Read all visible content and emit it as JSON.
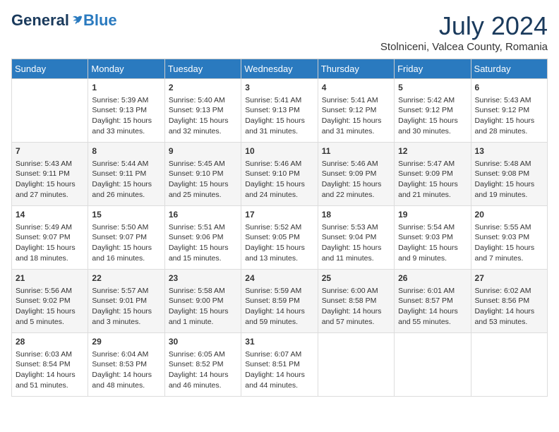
{
  "header": {
    "logo_general": "General",
    "logo_blue": "Blue",
    "title": "July 2024",
    "location": "Stolniceni, Valcea County, Romania"
  },
  "days_of_week": [
    "Sunday",
    "Monday",
    "Tuesday",
    "Wednesday",
    "Thursday",
    "Friday",
    "Saturday"
  ],
  "weeks": [
    [
      {
        "day": "",
        "info": ""
      },
      {
        "day": "1",
        "info": "Sunrise: 5:39 AM\nSunset: 9:13 PM\nDaylight: 15 hours\nand 33 minutes."
      },
      {
        "day": "2",
        "info": "Sunrise: 5:40 AM\nSunset: 9:13 PM\nDaylight: 15 hours\nand 32 minutes."
      },
      {
        "day": "3",
        "info": "Sunrise: 5:41 AM\nSunset: 9:13 PM\nDaylight: 15 hours\nand 31 minutes."
      },
      {
        "day": "4",
        "info": "Sunrise: 5:41 AM\nSunset: 9:12 PM\nDaylight: 15 hours\nand 31 minutes."
      },
      {
        "day": "5",
        "info": "Sunrise: 5:42 AM\nSunset: 9:12 PM\nDaylight: 15 hours\nand 30 minutes."
      },
      {
        "day": "6",
        "info": "Sunrise: 5:43 AM\nSunset: 9:12 PM\nDaylight: 15 hours\nand 28 minutes."
      }
    ],
    [
      {
        "day": "7",
        "info": "Sunrise: 5:43 AM\nSunset: 9:11 PM\nDaylight: 15 hours\nand 27 minutes."
      },
      {
        "day": "8",
        "info": "Sunrise: 5:44 AM\nSunset: 9:11 PM\nDaylight: 15 hours\nand 26 minutes."
      },
      {
        "day": "9",
        "info": "Sunrise: 5:45 AM\nSunset: 9:10 PM\nDaylight: 15 hours\nand 25 minutes."
      },
      {
        "day": "10",
        "info": "Sunrise: 5:46 AM\nSunset: 9:10 PM\nDaylight: 15 hours\nand 24 minutes."
      },
      {
        "day": "11",
        "info": "Sunrise: 5:46 AM\nSunset: 9:09 PM\nDaylight: 15 hours\nand 22 minutes."
      },
      {
        "day": "12",
        "info": "Sunrise: 5:47 AM\nSunset: 9:09 PM\nDaylight: 15 hours\nand 21 minutes."
      },
      {
        "day": "13",
        "info": "Sunrise: 5:48 AM\nSunset: 9:08 PM\nDaylight: 15 hours\nand 19 minutes."
      }
    ],
    [
      {
        "day": "14",
        "info": "Sunrise: 5:49 AM\nSunset: 9:07 PM\nDaylight: 15 hours\nand 18 minutes."
      },
      {
        "day": "15",
        "info": "Sunrise: 5:50 AM\nSunset: 9:07 PM\nDaylight: 15 hours\nand 16 minutes."
      },
      {
        "day": "16",
        "info": "Sunrise: 5:51 AM\nSunset: 9:06 PM\nDaylight: 15 hours\nand 15 minutes."
      },
      {
        "day": "17",
        "info": "Sunrise: 5:52 AM\nSunset: 9:05 PM\nDaylight: 15 hours\nand 13 minutes."
      },
      {
        "day": "18",
        "info": "Sunrise: 5:53 AM\nSunset: 9:04 PM\nDaylight: 15 hours\nand 11 minutes."
      },
      {
        "day": "19",
        "info": "Sunrise: 5:54 AM\nSunset: 9:03 PM\nDaylight: 15 hours\nand 9 minutes."
      },
      {
        "day": "20",
        "info": "Sunrise: 5:55 AM\nSunset: 9:03 PM\nDaylight: 15 hours\nand 7 minutes."
      }
    ],
    [
      {
        "day": "21",
        "info": "Sunrise: 5:56 AM\nSunset: 9:02 PM\nDaylight: 15 hours\nand 5 minutes."
      },
      {
        "day": "22",
        "info": "Sunrise: 5:57 AM\nSunset: 9:01 PM\nDaylight: 15 hours\nand 3 minutes."
      },
      {
        "day": "23",
        "info": "Sunrise: 5:58 AM\nSunset: 9:00 PM\nDaylight: 15 hours\nand 1 minute."
      },
      {
        "day": "24",
        "info": "Sunrise: 5:59 AM\nSunset: 8:59 PM\nDaylight: 14 hours\nand 59 minutes."
      },
      {
        "day": "25",
        "info": "Sunrise: 6:00 AM\nSunset: 8:58 PM\nDaylight: 14 hours\nand 57 minutes."
      },
      {
        "day": "26",
        "info": "Sunrise: 6:01 AM\nSunset: 8:57 PM\nDaylight: 14 hours\nand 55 minutes."
      },
      {
        "day": "27",
        "info": "Sunrise: 6:02 AM\nSunset: 8:56 PM\nDaylight: 14 hours\nand 53 minutes."
      }
    ],
    [
      {
        "day": "28",
        "info": "Sunrise: 6:03 AM\nSunset: 8:54 PM\nDaylight: 14 hours\nand 51 minutes."
      },
      {
        "day": "29",
        "info": "Sunrise: 6:04 AM\nSunset: 8:53 PM\nDaylight: 14 hours\nand 48 minutes."
      },
      {
        "day": "30",
        "info": "Sunrise: 6:05 AM\nSunset: 8:52 PM\nDaylight: 14 hours\nand 46 minutes."
      },
      {
        "day": "31",
        "info": "Sunrise: 6:07 AM\nSunset: 8:51 PM\nDaylight: 14 hours\nand 44 minutes."
      },
      {
        "day": "",
        "info": ""
      },
      {
        "day": "",
        "info": ""
      },
      {
        "day": "",
        "info": ""
      }
    ]
  ]
}
